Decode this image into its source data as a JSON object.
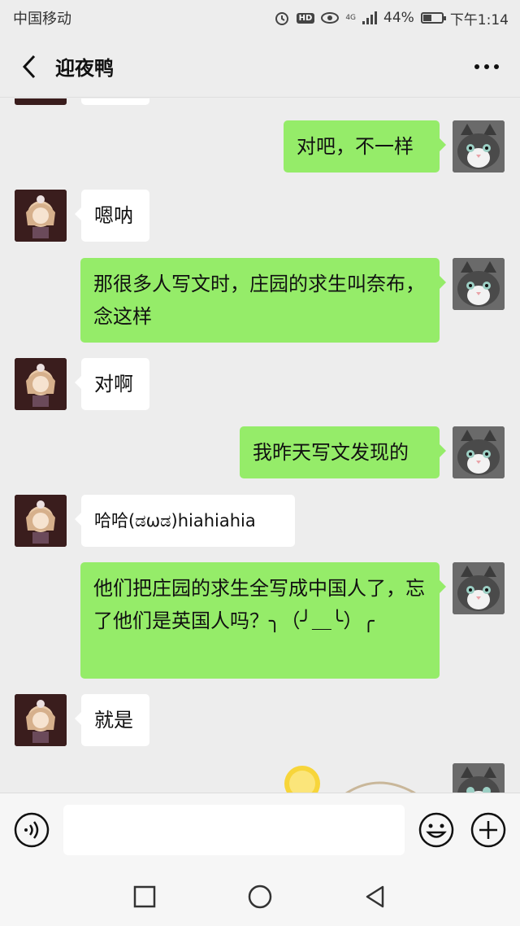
{
  "status_bar": {
    "carrier": "中国移动",
    "hd_badge": "HD",
    "network": "4G",
    "battery": "44%",
    "battery_level": 0.44,
    "time": "下午1:14"
  },
  "header": {
    "title": "迎夜鸭",
    "back_icon": "chevron-left-icon",
    "more_icon": "more-dots-icon"
  },
  "messages": [
    {
      "side": "right",
      "text": "对吧，不一样"
    },
    {
      "side": "left",
      "text": "嗯呐"
    },
    {
      "side": "right",
      "text": "那很多人写文时，庄园的求生叫奈布，念这样"
    },
    {
      "side": "left",
      "text": "对啊"
    },
    {
      "side": "right",
      "text": "我昨天写文发现的"
    },
    {
      "side": "left",
      "text": "哈哈(ಡωಡ)hiahiahia"
    },
    {
      "side": "right",
      "text": "他们把庄园的求生全写成中国人了，忘了他们是英国人吗？╮（╯＿╰）╭"
    },
    {
      "side": "left",
      "text": "就是"
    }
  ],
  "input_bar": {
    "placeholder": "",
    "voice_icon": "voice-icon",
    "emoji_icon": "emoji-icon",
    "plus_icon": "plus-icon"
  },
  "colors": {
    "background": "#ededed",
    "sent_bubble": "#95ec69",
    "received_bubble": "#ffffff"
  }
}
